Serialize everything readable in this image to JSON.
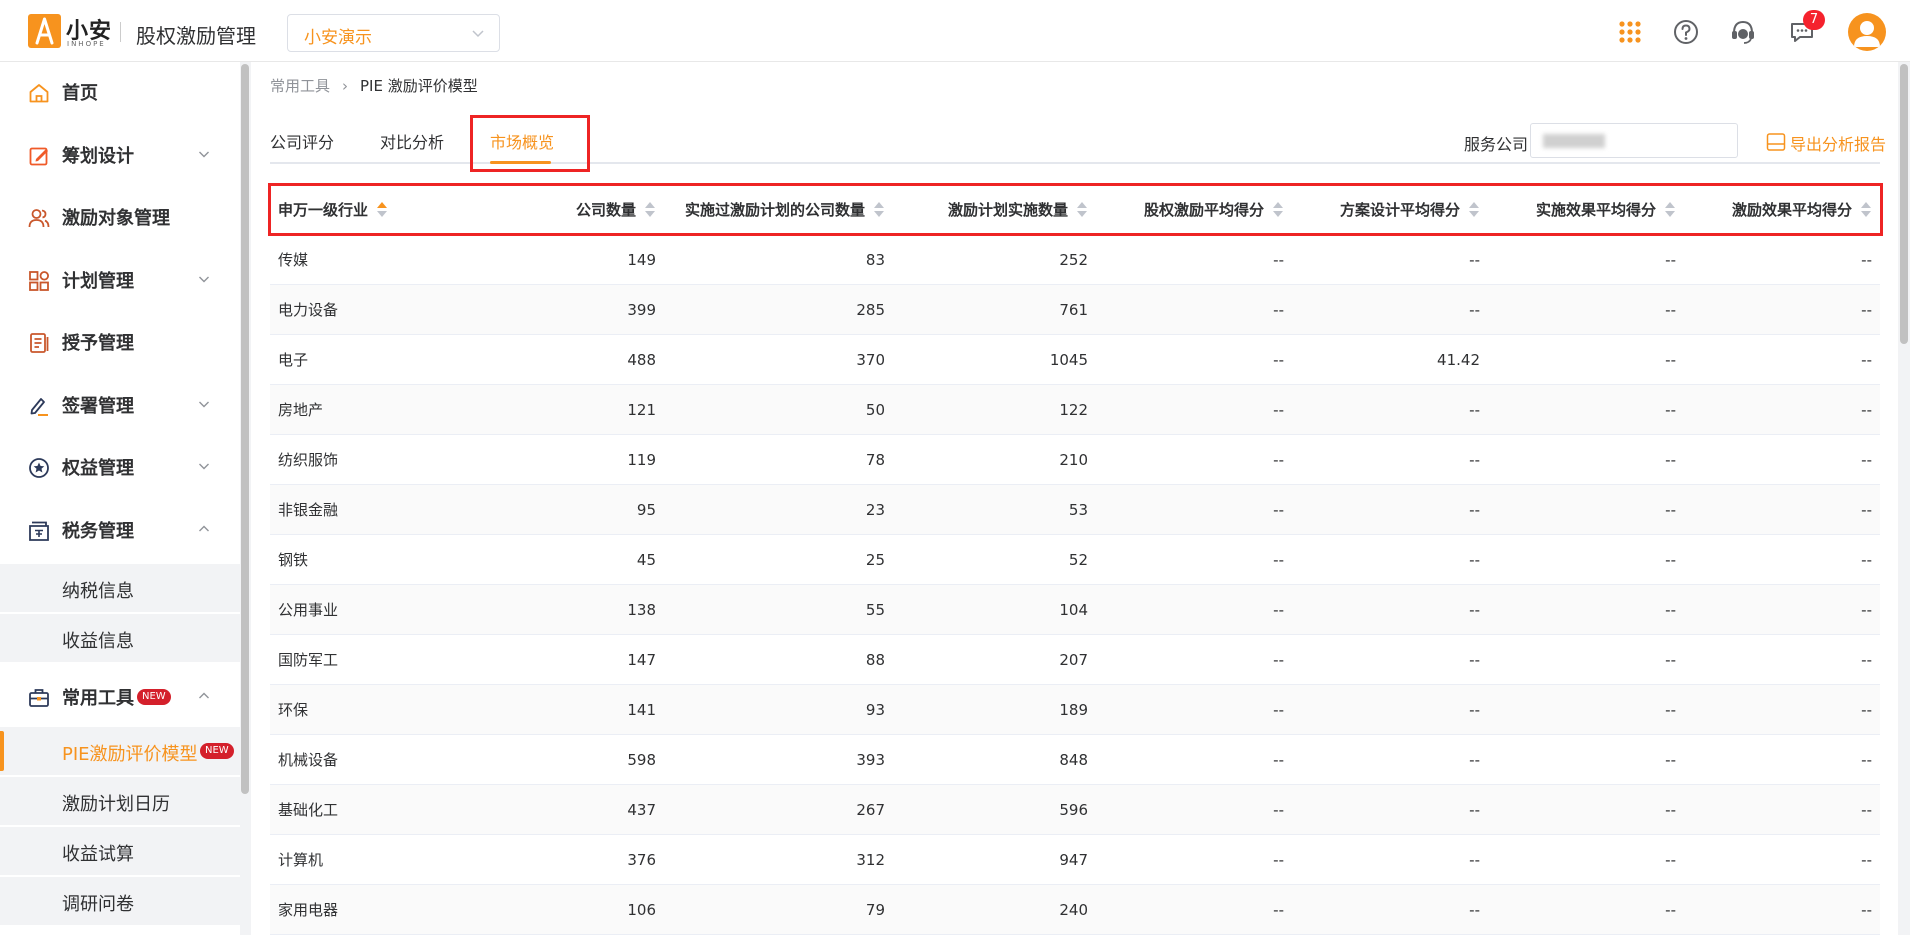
{
  "header": {
    "logo_name": "小安",
    "logo_sub": "INHOPE",
    "app_title": "股权激励管理",
    "company_select": "小安演示",
    "message_badge": "7"
  },
  "sidebar": {
    "items": [
      {
        "label": "首页"
      },
      {
        "label": "筹划设计"
      },
      {
        "label": "激励对象管理"
      },
      {
        "label": "计划管理"
      },
      {
        "label": "授予管理"
      },
      {
        "label": "签署管理"
      },
      {
        "label": "权益管理"
      },
      {
        "label": "税务管理"
      }
    ],
    "tax_sub": [
      "纳税信息",
      "收益信息"
    ],
    "tools": {
      "label": "常用工具",
      "tag": "NEW"
    },
    "tools_sub": [
      {
        "label": "PIE激励评价模型",
        "tag": "NEW"
      },
      {
        "label": "激励计划日历"
      },
      {
        "label": "收益试算"
      },
      {
        "label": "调研问卷"
      }
    ]
  },
  "breadcrumb": {
    "root": "常用工具",
    "current": "PIE 激励评价模型"
  },
  "tabs": [
    "公司评分",
    "对比分析",
    "市场概览"
  ],
  "service": {
    "label": "服务公司"
  },
  "export_label": "导出分析报告",
  "table": {
    "columns": [
      "申万一级行业",
      "公司数量",
      "实施过激励计划的公司数量",
      "激励计划实施数量",
      "股权激励平均得分",
      "方案设计平均得分",
      "实施效果平均得分",
      "激励效果平均得分"
    ],
    "rows": [
      [
        "传媒",
        "149",
        "83",
        "252",
        "--",
        "--",
        "--",
        "--"
      ],
      [
        "电力设备",
        "399",
        "285",
        "761",
        "--",
        "--",
        "--",
        "--"
      ],
      [
        "电子",
        "488",
        "370",
        "1045",
        "--",
        "41.42",
        "--",
        "--"
      ],
      [
        "房地产",
        "121",
        "50",
        "122",
        "--",
        "--",
        "--",
        "--"
      ],
      [
        "纺织服饰",
        "119",
        "78",
        "210",
        "--",
        "--",
        "--",
        "--"
      ],
      [
        "非银金融",
        "95",
        "23",
        "53",
        "--",
        "--",
        "--",
        "--"
      ],
      [
        "钢铁",
        "45",
        "25",
        "52",
        "--",
        "--",
        "--",
        "--"
      ],
      [
        "公用事业",
        "138",
        "55",
        "104",
        "--",
        "--",
        "--",
        "--"
      ],
      [
        "国防军工",
        "147",
        "88",
        "207",
        "--",
        "--",
        "--",
        "--"
      ],
      [
        "环保",
        "141",
        "93",
        "189",
        "--",
        "--",
        "--",
        "--"
      ],
      [
        "机械设备",
        "598",
        "393",
        "848",
        "--",
        "--",
        "--",
        "--"
      ],
      [
        "基础化工",
        "437",
        "267",
        "596",
        "--",
        "--",
        "--",
        "--"
      ],
      [
        "计算机",
        "376",
        "312",
        "947",
        "--",
        "--",
        "--",
        "--"
      ],
      [
        "家用电器",
        "106",
        "79",
        "240",
        "--",
        "--",
        "--",
        "--"
      ]
    ]
  },
  "colors": {
    "accent": "#f7931e",
    "highlight": "#ee2424",
    "badge": "#f5222d",
    "new_tag": "#d4202b"
  }
}
